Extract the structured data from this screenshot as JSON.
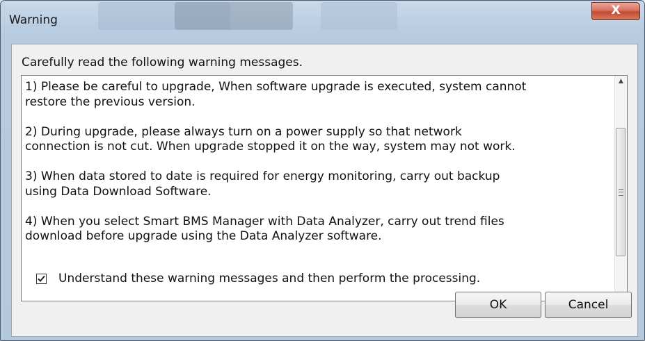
{
  "window": {
    "title": "Warning",
    "close_symbol": "X"
  },
  "dialog": {
    "header": "Carefully read the following warning messages.",
    "messages": [
      {
        "lines": [
          "1) Please be careful to upgrade, When software upgrade is executed, system cannot",
          "restore the previous version."
        ]
      },
      {
        "lines": [
          "2) During upgrade, please always turn on a power supply so that network",
          "connection is not cut. When upgrade stopped it on the way, system may not work."
        ]
      },
      {
        "lines": [
          "3) When data stored to date is required for energy monitoring, carry out backup",
          "using Data Download Software."
        ]
      },
      {
        "lines": [
          "4) When you select Smart BMS Manager with Data Analyzer, carry out trend files",
          "download before upgrade using the Data Analyzer software."
        ]
      }
    ],
    "checkbox": {
      "label": "Understand these warning messages and then perform the processing.",
      "checked": true
    },
    "buttons": {
      "ok": "OK",
      "cancel": "Cancel"
    }
  },
  "scrollbar": {
    "up_arrow_icon": "scroll-up-icon",
    "down_arrow_icon": "scroll-down-icon",
    "grip_icon": "grip-icon"
  }
}
